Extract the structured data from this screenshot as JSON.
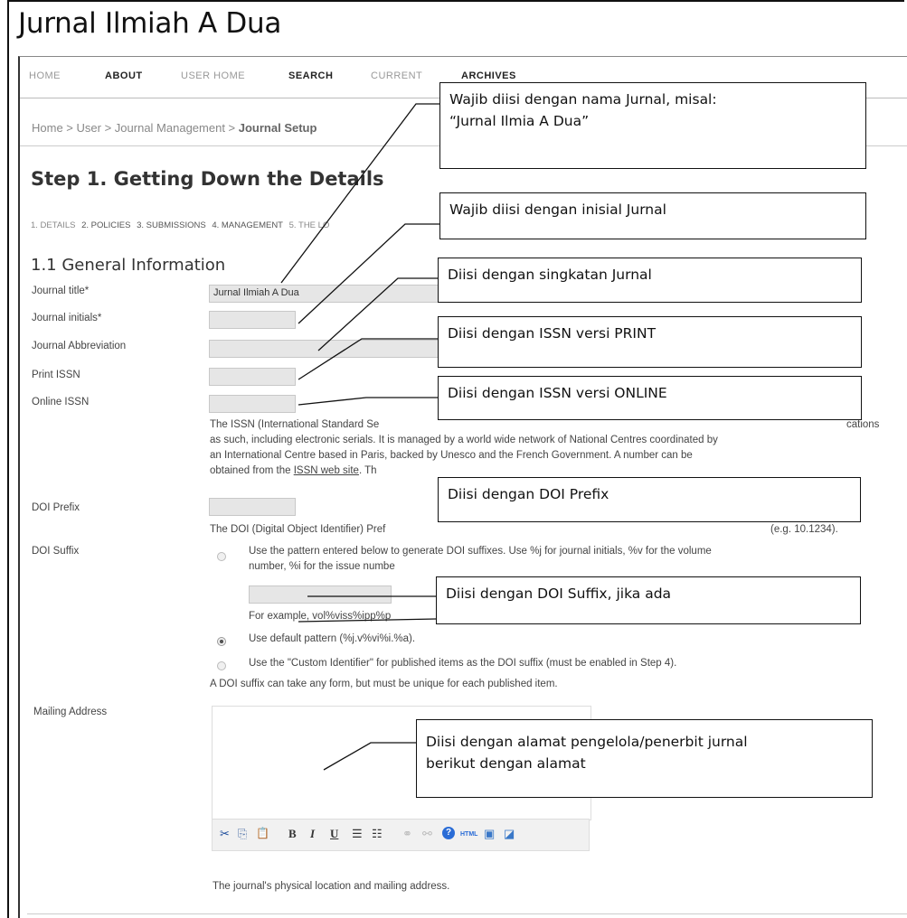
{
  "site": {
    "title": "Jurnal Ilmiah A Dua"
  },
  "nav": {
    "items": [
      {
        "label": "HOME",
        "style": "light"
      },
      {
        "label": "ABOUT",
        "style": "bold"
      },
      {
        "label": "USER HOME",
        "style": "light"
      },
      {
        "label": "SEARCH",
        "style": "bold"
      },
      {
        "label": "CURRENT",
        "style": "light"
      },
      {
        "label": "ARCHIVES",
        "style": "bold"
      }
    ]
  },
  "breadcrumb": {
    "part1": "Home",
    "sep": " > ",
    "part2": "User",
    "part3": "Journal Management",
    "current": "Journal Setup"
  },
  "page": {
    "step_title": "Step 1. Getting Down the Details",
    "tabs": [
      "1. DETAILS",
      "2. POLICIES",
      "3. SUBMISSIONS",
      "4. MANAGEMENT",
      "5. THE LO"
    ],
    "section_title": "1.1 General Information"
  },
  "form": {
    "journal_title_label": "Journal title*",
    "journal_title_value": "Jurnal Ilmiah A Dua",
    "journal_initials_label": "Journal initials*",
    "journal_abbrev_label": "Journal Abbreviation",
    "print_issn_label": "Print ISSN",
    "online_issn_label": "Online ISSN",
    "issn_help_1": "The ISSN (International Standard Se",
    "issn_help_1b": "cations",
    "issn_help_2": "as such, including electronic serials. It is managed by a world wide network of National Centres coordinated by",
    "issn_help_3": "an International Centre based in Paris, backed by Unesco and the French Government. A number can be",
    "issn_help_4a": "obtained from the ",
    "issn_help_4_link": "ISSN web site",
    "issn_help_4b": ". Th",
    "doi_prefix_label": "DOI Prefix",
    "doi_prefix_help": "The DOI (Digital Object Identifier) Pref",
    "doi_prefix_help_b": "(e.g. 10.1234).",
    "doi_suffix_label": "DOI Suffix",
    "doi_opt1_line1": "Use the pattern entered below to generate DOI suffixes. Use %j for journal initials, %v for the volume",
    "doi_opt1_line2": "number, %i for the issue numbe",
    "doi_example": "For example, vol%viss%ipp%p",
    "doi_opt2": "Use default pattern (%j.v%vi%i.%a).",
    "doi_opt3": "Use the \"Custom Identifier\" for published items as the DOI suffix (must be enabled in Step 4).",
    "doi_note": "A DOI suffix can take any form, but must be unique for each published item.",
    "mailing_label": "Mailing Address",
    "mailing_help": "The journal's physical location and mailing address."
  },
  "toolbar": {
    "cut": "✂",
    "copy": "⎘",
    "paste": "📋",
    "bold": "B",
    "italic": "I",
    "underline": "U",
    "bullets": "☰",
    "numbers": "☷",
    "link": "⚭",
    "unlink": "⚯",
    "help": "?",
    "html": "HTML",
    "image": "▣",
    "fullscreen": "◪"
  },
  "callouts": {
    "title": [
      "Wajib diisi dengan nama Jurnal, misal:",
      "“Jurnal Ilmia A Dua”"
    ],
    "initials": "Wajib diisi dengan inisial Jurnal",
    "abbrev": "Diisi dengan singkatan Jurnal",
    "print_issn": "Diisi dengan ISSN versi PRINT",
    "online_issn": "Diisi dengan ISSN versi ONLINE",
    "doi_prefix": "Diisi dengan DOI Prefix",
    "doi_suffix": "Diisi dengan DOI Suffix, jika ada",
    "mailing": [
      "Diisi dengan alamat pengelola/penerbit  jurnal",
      "berikut dengan alamat"
    ]
  }
}
